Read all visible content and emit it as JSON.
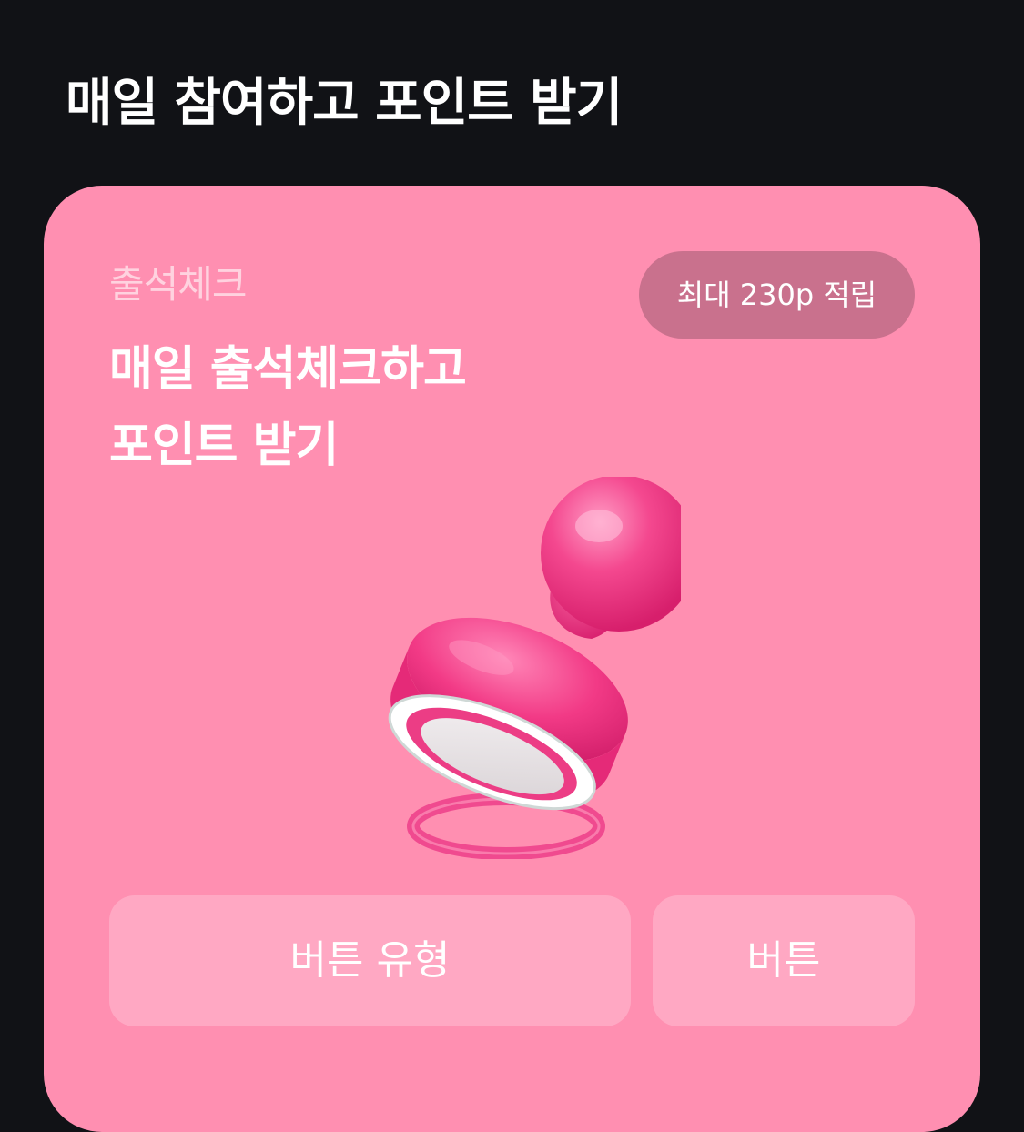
{
  "section": {
    "title": "매일 참여하고 포인트 받기"
  },
  "card": {
    "eyebrow": "출석체크",
    "heading_lines": [
      "매일 출석체크하고",
      "포인트 받기"
    ],
    "badge": "최대 230p 적립",
    "illustration": "stamp-icon",
    "buttons": {
      "primary_label": "버튼 유형",
      "secondary_label": "버튼"
    }
  },
  "colors": {
    "background": "#111216",
    "card": "#ff8fb1",
    "badge": "#c9718d",
    "button": "#ffa8c3",
    "stamp": "#f23a86"
  }
}
